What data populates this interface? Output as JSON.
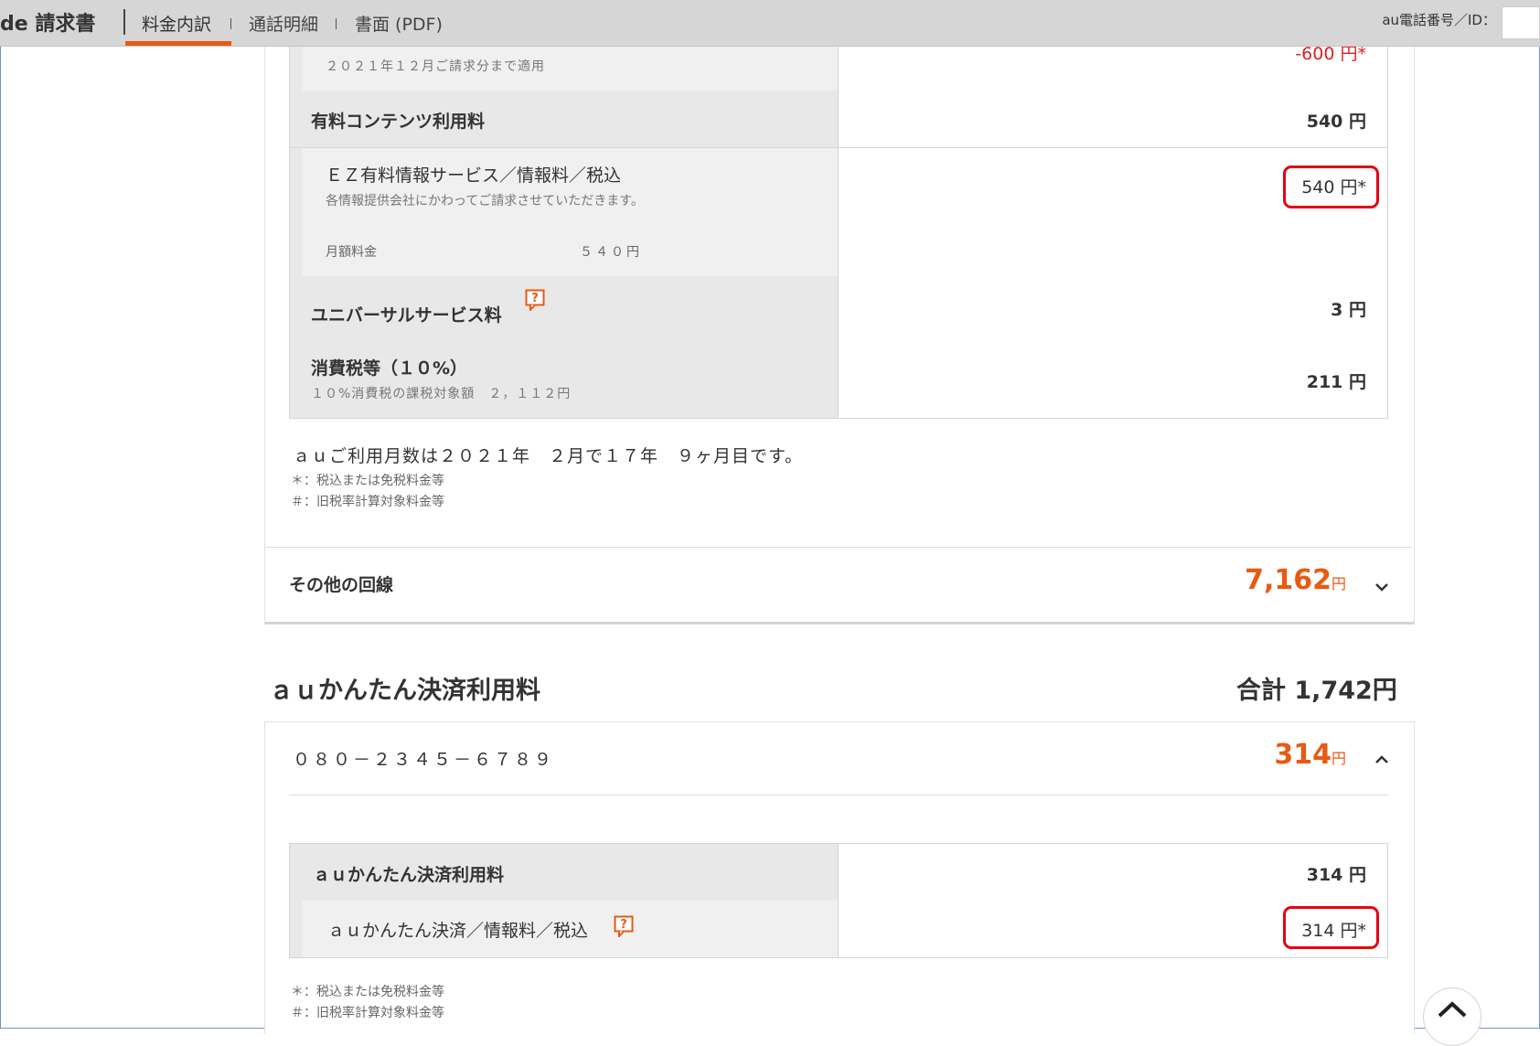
{
  "header": {
    "brand": "de 請求書",
    "tabs": [
      {
        "label": "料金内訳",
        "active": true
      },
      {
        "label": "通話明細",
        "active": false
      },
      {
        "label": "書面 (PDF)",
        "active": false
      }
    ],
    "id_label": "au電話番号／ID："
  },
  "line_detail": {
    "discount": {
      "sub": "２０２１年１２月ご請求分まで適用",
      "amount": "-600 円*"
    },
    "content": {
      "label": "有料コンテンツ利用料",
      "amount": "540 円",
      "item": {
        "label": "ＥＺ有料情報サービス／情報料／税込",
        "sub": "各情報提供会社にかわってご請求させていただきます。",
        "amount": "540 円*"
      },
      "monthly": {
        "label": "月額料金",
        "value": "５４０円"
      }
    },
    "universal": {
      "label": "ユニバーサルサービス料",
      "amount": "3 円"
    },
    "tax": {
      "label": "消費税等（１０%）",
      "sub": "１０%消費税の課税対象額　２，１１２円",
      "amount": "211 円"
    },
    "usage_info": "ａｕご利用月数は２０２１年　２月で１７年　９ヶ月目です。",
    "note1": "＊：税込または免税料金等",
    "note2": "＃：旧税率計算対象料金等"
  },
  "other_lines": {
    "label": "その他の回線",
    "amount": "7,162",
    "unit": "円"
  },
  "kantan": {
    "title": "ａｕかんたん決済利用料",
    "total": "合計 1,742円",
    "phone": "０８０－２３４５－６７８９",
    "amount": "314",
    "unit": "円",
    "row_label": "ａｕかんたん決済利用料",
    "row_amount": "314 円",
    "item_label": "ａｕかんたん決済／情報料／税込",
    "item_amount": "314 円*",
    "note1": "＊：税込または免税料金等",
    "note2": "＃：旧税率計算対象料金等"
  },
  "colors": {
    "accent": "#e85a12",
    "highlight": "#e60012",
    "discount": "#e02020"
  },
  "icons": [
    "help-icon",
    "chevron-down-icon",
    "chevron-up-icon"
  ]
}
